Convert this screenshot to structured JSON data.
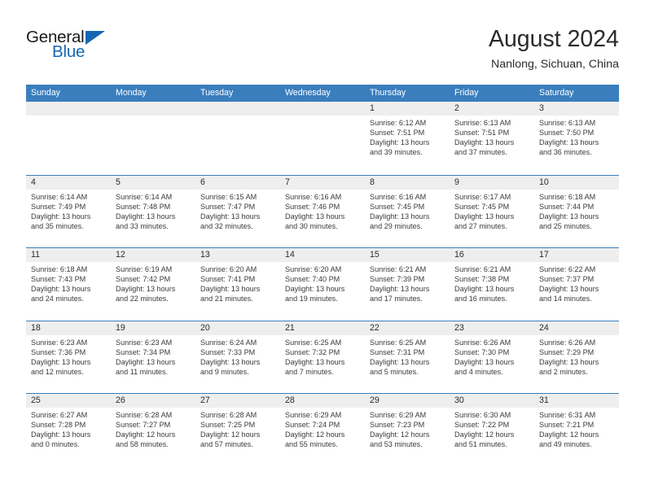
{
  "brand": {
    "word_general": "General",
    "word_blue": "Blue",
    "logo_color": "#1567b3"
  },
  "header": {
    "title": "August 2024",
    "subtitle": "Nanlong, Sichuan, China"
  },
  "theme": {
    "header_blue": "#3a7ebd",
    "day_band_gray": "#eeeeee",
    "text_dark": "#2b2b2b",
    "body_text": "#3a3a3a"
  },
  "weekday_headers": [
    "Sunday",
    "Monday",
    "Tuesday",
    "Wednesday",
    "Thursday",
    "Friday",
    "Saturday"
  ],
  "labels": {
    "sunrise_prefix": "Sunrise:",
    "sunset_prefix": "Sunset:",
    "daylight_prefix": "Daylight:"
  },
  "weeks": [
    [
      {
        "day": "",
        "empty": true
      },
      {
        "day": "",
        "empty": true
      },
      {
        "day": "",
        "empty": true
      },
      {
        "day": "",
        "empty": true
      },
      {
        "day": "1",
        "sunrise": "Sunrise: 6:12 AM",
        "sunset": "Sunset: 7:51 PM",
        "daylight1": "Daylight: 13 hours",
        "daylight2": "and 39 minutes."
      },
      {
        "day": "2",
        "sunrise": "Sunrise: 6:13 AM",
        "sunset": "Sunset: 7:51 PM",
        "daylight1": "Daylight: 13 hours",
        "daylight2": "and 37 minutes."
      },
      {
        "day": "3",
        "sunrise": "Sunrise: 6:13 AM",
        "sunset": "Sunset: 7:50 PM",
        "daylight1": "Daylight: 13 hours",
        "daylight2": "and 36 minutes."
      }
    ],
    [
      {
        "day": "4",
        "sunrise": "Sunrise: 6:14 AM",
        "sunset": "Sunset: 7:49 PM",
        "daylight1": "Daylight: 13 hours",
        "daylight2": "and 35 minutes."
      },
      {
        "day": "5",
        "sunrise": "Sunrise: 6:14 AM",
        "sunset": "Sunset: 7:48 PM",
        "daylight1": "Daylight: 13 hours",
        "daylight2": "and 33 minutes."
      },
      {
        "day": "6",
        "sunrise": "Sunrise: 6:15 AM",
        "sunset": "Sunset: 7:47 PM",
        "daylight1": "Daylight: 13 hours",
        "daylight2": "and 32 minutes."
      },
      {
        "day": "7",
        "sunrise": "Sunrise: 6:16 AM",
        "sunset": "Sunset: 7:46 PM",
        "daylight1": "Daylight: 13 hours",
        "daylight2": "and 30 minutes."
      },
      {
        "day": "8",
        "sunrise": "Sunrise: 6:16 AM",
        "sunset": "Sunset: 7:45 PM",
        "daylight1": "Daylight: 13 hours",
        "daylight2": "and 29 minutes."
      },
      {
        "day": "9",
        "sunrise": "Sunrise: 6:17 AM",
        "sunset": "Sunset: 7:45 PM",
        "daylight1": "Daylight: 13 hours",
        "daylight2": "and 27 minutes."
      },
      {
        "day": "10",
        "sunrise": "Sunrise: 6:18 AM",
        "sunset": "Sunset: 7:44 PM",
        "daylight1": "Daylight: 13 hours",
        "daylight2": "and 25 minutes."
      }
    ],
    [
      {
        "day": "11",
        "sunrise": "Sunrise: 6:18 AM",
        "sunset": "Sunset: 7:43 PM",
        "daylight1": "Daylight: 13 hours",
        "daylight2": "and 24 minutes."
      },
      {
        "day": "12",
        "sunrise": "Sunrise: 6:19 AM",
        "sunset": "Sunset: 7:42 PM",
        "daylight1": "Daylight: 13 hours",
        "daylight2": "and 22 minutes."
      },
      {
        "day": "13",
        "sunrise": "Sunrise: 6:20 AM",
        "sunset": "Sunset: 7:41 PM",
        "daylight1": "Daylight: 13 hours",
        "daylight2": "and 21 minutes."
      },
      {
        "day": "14",
        "sunrise": "Sunrise: 6:20 AM",
        "sunset": "Sunset: 7:40 PM",
        "daylight1": "Daylight: 13 hours",
        "daylight2": "and 19 minutes."
      },
      {
        "day": "15",
        "sunrise": "Sunrise: 6:21 AM",
        "sunset": "Sunset: 7:39 PM",
        "daylight1": "Daylight: 13 hours",
        "daylight2": "and 17 minutes."
      },
      {
        "day": "16",
        "sunrise": "Sunrise: 6:21 AM",
        "sunset": "Sunset: 7:38 PM",
        "daylight1": "Daylight: 13 hours",
        "daylight2": "and 16 minutes."
      },
      {
        "day": "17",
        "sunrise": "Sunrise: 6:22 AM",
        "sunset": "Sunset: 7:37 PM",
        "daylight1": "Daylight: 13 hours",
        "daylight2": "and 14 minutes."
      }
    ],
    [
      {
        "day": "18",
        "sunrise": "Sunrise: 6:23 AM",
        "sunset": "Sunset: 7:36 PM",
        "daylight1": "Daylight: 13 hours",
        "daylight2": "and 12 minutes."
      },
      {
        "day": "19",
        "sunrise": "Sunrise: 6:23 AM",
        "sunset": "Sunset: 7:34 PM",
        "daylight1": "Daylight: 13 hours",
        "daylight2": "and 11 minutes."
      },
      {
        "day": "20",
        "sunrise": "Sunrise: 6:24 AM",
        "sunset": "Sunset: 7:33 PM",
        "daylight1": "Daylight: 13 hours",
        "daylight2": "and 9 minutes."
      },
      {
        "day": "21",
        "sunrise": "Sunrise: 6:25 AM",
        "sunset": "Sunset: 7:32 PM",
        "daylight1": "Daylight: 13 hours",
        "daylight2": "and 7 minutes."
      },
      {
        "day": "22",
        "sunrise": "Sunrise: 6:25 AM",
        "sunset": "Sunset: 7:31 PM",
        "daylight1": "Daylight: 13 hours",
        "daylight2": "and 5 minutes."
      },
      {
        "day": "23",
        "sunrise": "Sunrise: 6:26 AM",
        "sunset": "Sunset: 7:30 PM",
        "daylight1": "Daylight: 13 hours",
        "daylight2": "and 4 minutes."
      },
      {
        "day": "24",
        "sunrise": "Sunrise: 6:26 AM",
        "sunset": "Sunset: 7:29 PM",
        "daylight1": "Daylight: 13 hours",
        "daylight2": "and 2 minutes."
      }
    ],
    [
      {
        "day": "25",
        "sunrise": "Sunrise: 6:27 AM",
        "sunset": "Sunset: 7:28 PM",
        "daylight1": "Daylight: 13 hours",
        "daylight2": "and 0 minutes."
      },
      {
        "day": "26",
        "sunrise": "Sunrise: 6:28 AM",
        "sunset": "Sunset: 7:27 PM",
        "daylight1": "Daylight: 12 hours",
        "daylight2": "and 58 minutes."
      },
      {
        "day": "27",
        "sunrise": "Sunrise: 6:28 AM",
        "sunset": "Sunset: 7:25 PM",
        "daylight1": "Daylight: 12 hours",
        "daylight2": "and 57 minutes."
      },
      {
        "day": "28",
        "sunrise": "Sunrise: 6:29 AM",
        "sunset": "Sunset: 7:24 PM",
        "daylight1": "Daylight: 12 hours",
        "daylight2": "and 55 minutes."
      },
      {
        "day": "29",
        "sunrise": "Sunrise: 6:29 AM",
        "sunset": "Sunset: 7:23 PM",
        "daylight1": "Daylight: 12 hours",
        "daylight2": "and 53 minutes."
      },
      {
        "day": "30",
        "sunrise": "Sunrise: 6:30 AM",
        "sunset": "Sunset: 7:22 PM",
        "daylight1": "Daylight: 12 hours",
        "daylight2": "and 51 minutes."
      },
      {
        "day": "31",
        "sunrise": "Sunrise: 6:31 AM",
        "sunset": "Sunset: 7:21 PM",
        "daylight1": "Daylight: 12 hours",
        "daylight2": "and 49 minutes."
      }
    ]
  ]
}
